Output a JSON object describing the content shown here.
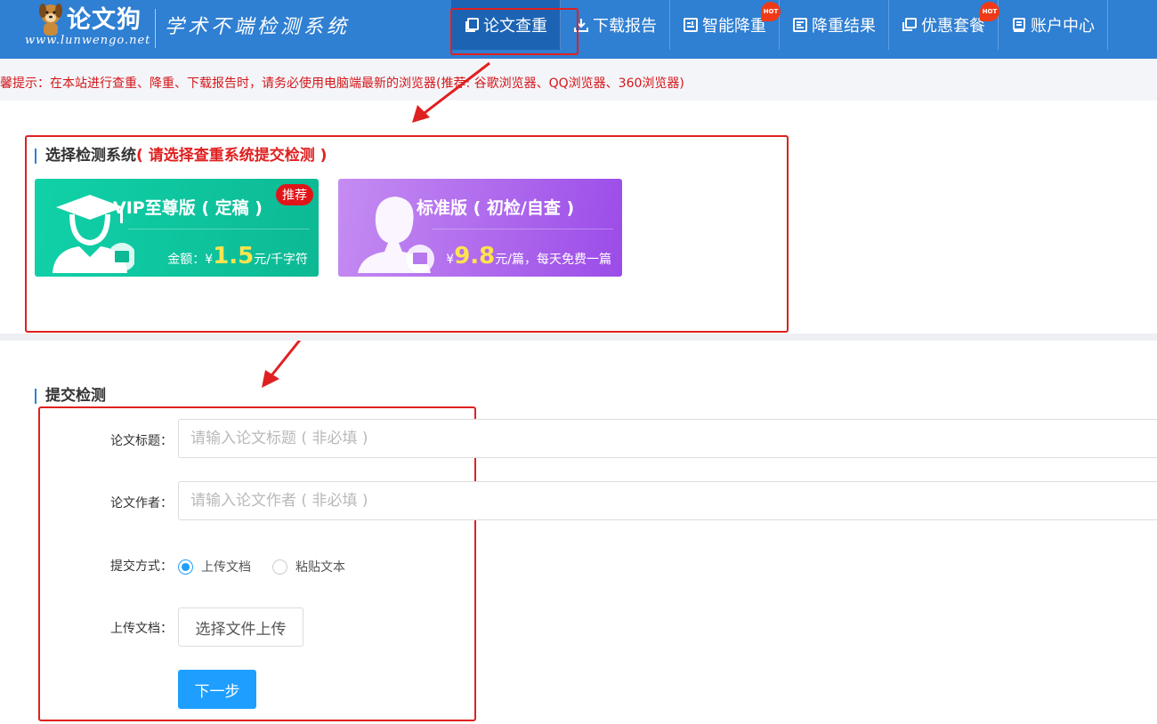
{
  "header": {
    "logo_name": "论文狗",
    "logo_url": "www.lunwengo.net",
    "slogan": "学术不端检测系统",
    "nav": [
      {
        "label": "论文查重",
        "icon": "copy-icon",
        "active": true
      },
      {
        "label": "下载报告",
        "icon": "download-icon"
      },
      {
        "label": "智能降重",
        "icon": "smart-reduce-icon",
        "badge": "HOT"
      },
      {
        "label": "降重结果",
        "icon": "result-icon"
      },
      {
        "label": "优惠套餐",
        "icon": "package-icon",
        "badge": "HOT"
      },
      {
        "label": "账户中心",
        "icon": "account-icon"
      }
    ]
  },
  "tip": "温馨提示：在本站进行查重、降重、下载报告时，请务必使用电脑端最新的浏览器(推荐: 谷歌浏览器、QQ浏览器、360浏览器)",
  "select_system": {
    "title": "选择检测系统",
    "hint": "( 请选择查重系统提交检测 )",
    "cards": [
      {
        "name": "VIP至尊版 ( 定稿 )",
        "price_prefix": "金额：¥",
        "price": "1.5",
        "price_unit": "元/千字符",
        "badge": "推荐"
      },
      {
        "name": "标准版 ( 初检/自查 )",
        "price_prefix": "¥",
        "price": "9.8",
        "price_unit": "元/篇，每天免费一篇"
      }
    ]
  },
  "submit": {
    "title": "提交检测",
    "title_label": "论文标题：",
    "title_placeholder": "请输入论文标题 ( 非必填 )",
    "author_label": "论文作者：",
    "author_placeholder": "请输入论文作者 ( 非必填 )",
    "method_label": "提交方式：",
    "method_options": [
      "上传文档",
      "粘贴文本"
    ],
    "upload_label": "上传文档：",
    "upload_button": "选择文件上传",
    "next_button": "下一步"
  },
  "colors": {
    "header_blue": "#2f7fd2",
    "tip_red": "#d4161a",
    "button_blue": "#1e9fff",
    "vip_green": "#0cb995",
    "std_purple": "#9b4ce8",
    "annotation_red": "#e02020"
  }
}
